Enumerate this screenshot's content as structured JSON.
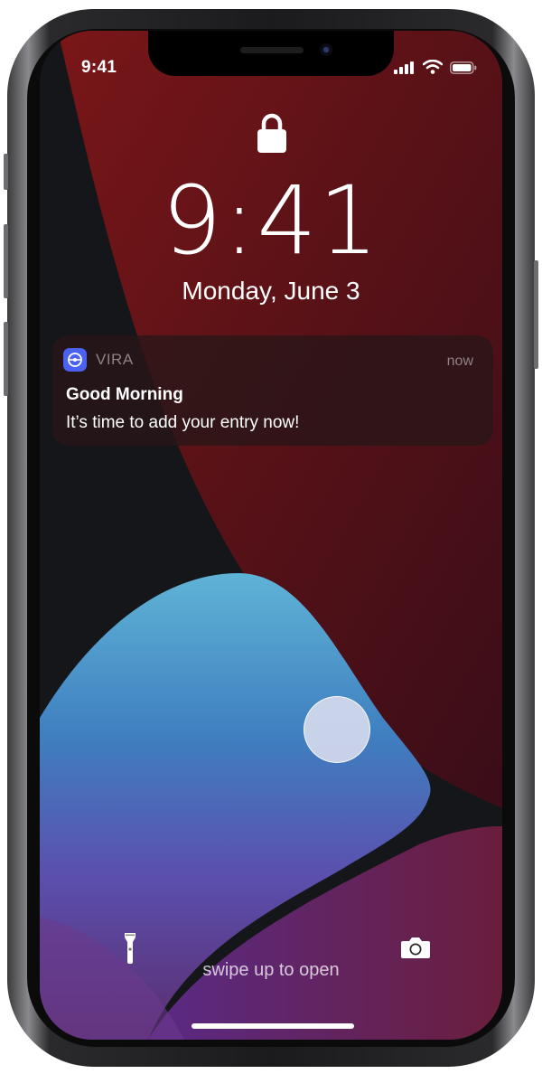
{
  "status_bar": {
    "time": "9:41",
    "icons": [
      "signal-icon",
      "wifi-icon",
      "battery-icon"
    ]
  },
  "lock_screen": {
    "lock_icon": "lock-icon",
    "time": "9:41",
    "date": "Monday, June 3"
  },
  "notification": {
    "app_name": "VIRA",
    "time": "now",
    "title": "Good Morning",
    "body": "It’s time to add your entry now!",
    "app_color": "#4b62f0"
  },
  "bottom": {
    "left_button_icon": "flashlight-icon",
    "right_button_icon": "camera-icon",
    "hint": "swipe up to open"
  }
}
